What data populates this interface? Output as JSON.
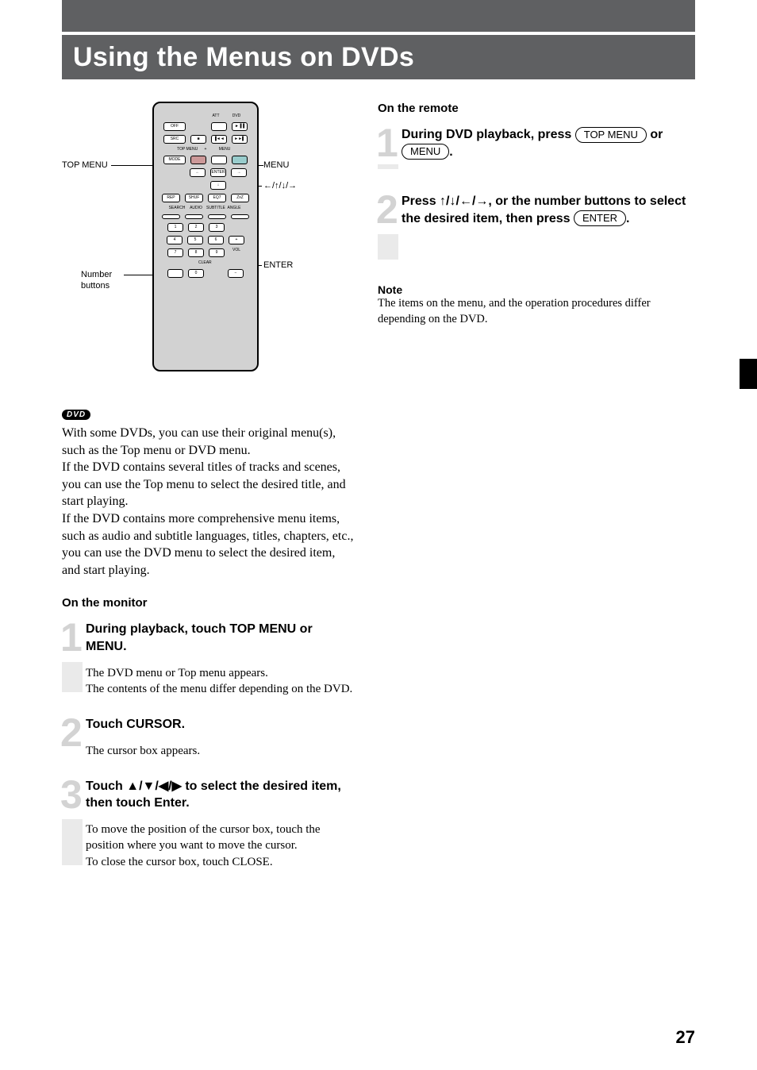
{
  "title": "Using the Menus on DVDs",
  "dvd_badge": "DVD",
  "page_number": "27",
  "remote_callouts": {
    "top_menu": "TOP MENU",
    "menu": "MENU",
    "enter": "ENTER",
    "arrows": "←/↑/↓/→",
    "number_buttons_l1": "Number",
    "number_buttons_l2": "buttons"
  },
  "remote_layout": {
    "labels": {
      "att": "ATT",
      "dvd": "DVD",
      "top_menu": "TOP MENU",
      "menu": "MENU",
      "search": "SEARCH",
      "audio": "AUDIO",
      "subtitle": "SUBTITLE",
      "angle": "ANGLE",
      "vol": "VOL",
      "clear": "CLEAR"
    },
    "buttons": {
      "off": "OFF",
      "att": "",
      "playpause": "►▐▐",
      "src": "SRC",
      "stop": "■",
      "prev": "▐◄◄",
      "next": "►►▌",
      "mode": "MODE",
      "red": "",
      "plus_dpad": "+",
      "blue": "",
      "left": "←",
      "enter": "ENTER",
      "right": "→",
      "arrowdown": "↓",
      "rep": "REP",
      "shuf": "SHUF",
      "eq7": "EQ7",
      "zxz": "ZxZ",
      "b1": "",
      "b2": "",
      "b3": "",
      "b4": "",
      "n1": "1",
      "n2": "2",
      "n3": "3",
      "n4": "4",
      "n5": "5",
      "n6": "6",
      "vol_up": "+",
      "n7": "7",
      "n8": "8",
      "n9": "9",
      "vol_lbl": "VOL",
      "n0": "0",
      "vol_dn": "−"
    }
  },
  "intro": {
    "p1": "With some DVDs, you can use their original menu(s), such as the Top menu or DVD menu.",
    "p2": "If the DVD contains several titles of tracks and scenes, you can use the Top menu to select the desired title, and start playing.",
    "p3": "If the DVD contains more comprehensive menu items, such as audio and subtitle languages, titles, chapters, etc., you can use the DVD menu to select the desired item, and start playing."
  },
  "monitor_heading": "On the monitor",
  "monitor_steps": {
    "s1": {
      "num": "1",
      "title": "During playback, touch TOP MENU or MENU.",
      "body_a": "The DVD menu or Top menu appears.",
      "body_b": "The contents of the menu differ depending on the DVD."
    },
    "s2": {
      "num": "2",
      "title": "Touch CURSOR.",
      "body_a": "The cursor box appears."
    },
    "s3": {
      "num": "3",
      "title": "Touch ▲/▼/◀/▶ to select the desired item, then touch Enter.",
      "body_a": "To move the position of the cursor box, touch the position where you want to move the cursor.",
      "body_b": "To close the cursor box, touch CLOSE."
    }
  },
  "remote_heading": "On the remote",
  "remote_steps": {
    "s1": {
      "num": "1",
      "pre": "During DVD playback, press ",
      "btn1": "TOP MENU",
      "mid": " or ",
      "btn2": "MENU",
      "post": "."
    },
    "s2": {
      "num": "2",
      "pre": "Press ",
      "arrows": "↑/↓/←/→",
      "mid": ", or the number buttons to select the desired item, then press ",
      "btn": "ENTER",
      "post": "."
    }
  },
  "note": {
    "heading": "Note",
    "text": "The items on the menu, and the operation procedures differ depending on the DVD."
  }
}
